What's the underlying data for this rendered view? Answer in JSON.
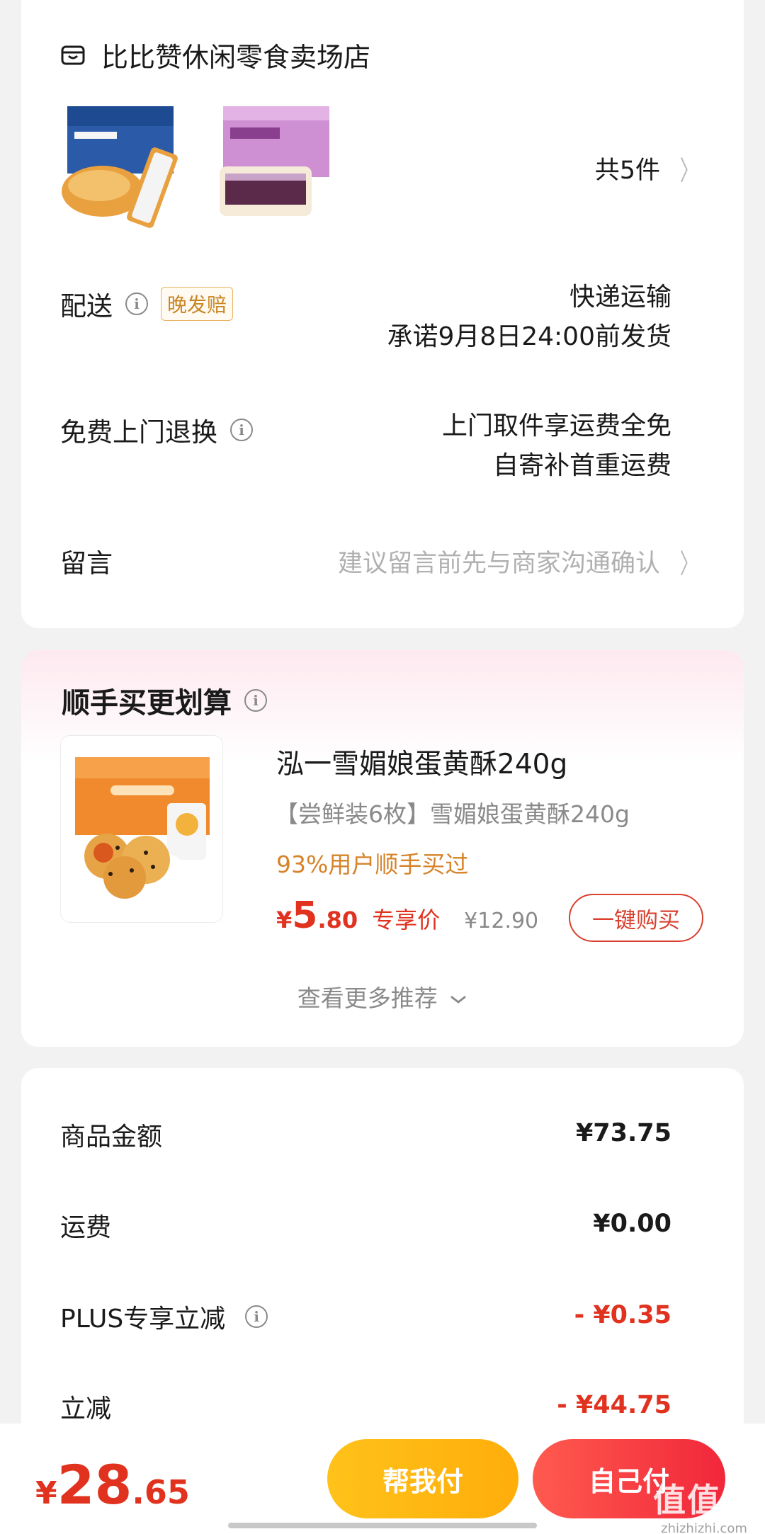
{
  "store": {
    "name": "比比赞休闲零食卖场店",
    "count_label": "共5件"
  },
  "delivery": {
    "label": "配送",
    "badge": "晚发赔",
    "method": "快递运输",
    "promise": "承诺9月8日24:00前发货"
  },
  "returns": {
    "label": "免费上门退换",
    "line1": "上门取件享运费全免",
    "line2": "自寄补首重运费"
  },
  "message": {
    "label": "留言",
    "placeholder": "建议留言前先与商家沟通确认"
  },
  "reco": {
    "title": "顺手买更划算",
    "product_name": "泓一雪媚娘蛋黄酥240g",
    "product_sub": "【尝鲜装6枚】雪媚娘蛋黄酥240g",
    "hot": "93%用户顺手买过",
    "price_symbol": "¥",
    "price_int": "5",
    "price_dec": ".80",
    "price_tag": "专享价",
    "price_orig": "¥12.90",
    "buy_label": "一键购买",
    "more_label": "查看更多推荐"
  },
  "summary": {
    "rows": [
      {
        "label": "商品金额",
        "value": "¥73.75"
      },
      {
        "label": "运费",
        "value": "¥0.00"
      },
      {
        "label": "PLUS专享立减",
        "value": "- ¥0.35"
      },
      {
        "label": "立减",
        "value": "- ¥44.75"
      }
    ]
  },
  "footer": {
    "total_symbol": "¥",
    "total_int": "28",
    "total_dec": ".65",
    "help_pay": "帮我付",
    "self_pay": "自己付"
  },
  "watermark": {
    "main": "值值值",
    "sub": "zhizhizhi.com"
  },
  "colors": {
    "accent_red": "#e0321f",
    "accent_orange": "#d6832a",
    "help_button": "#ffc21a",
    "self_button": "#f1273a"
  }
}
